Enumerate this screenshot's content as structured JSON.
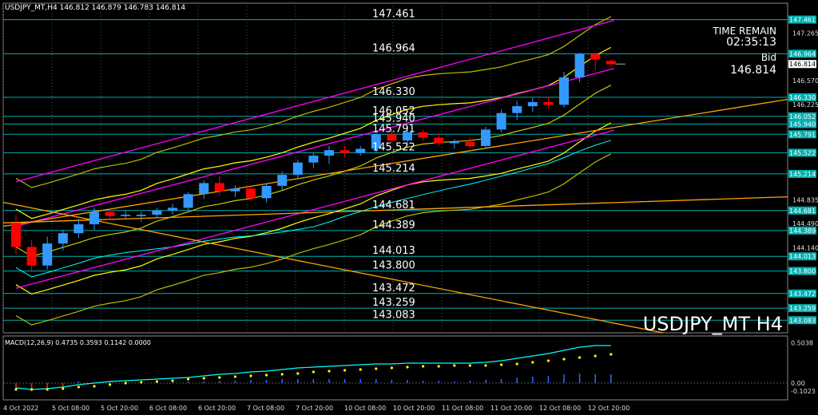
{
  "header": {
    "symbol_info": "USDJPY_MT,H4  146.812 146.879 146.783 146.814"
  },
  "watermark": "USDJPY_MT H4",
  "time_remain": {
    "label": "TIME REMAIN",
    "value": "02:35:13"
  },
  "bid": {
    "label": "Bid",
    "value": "146.814"
  },
  "colors": {
    "background": "#000000",
    "bull": "#3399ff",
    "bear": "#ff0000",
    "level_line": "#00b0b0",
    "yellow": "#ffff00",
    "magenta": "#ff00ff",
    "orange": "#ffa500",
    "cyan": "#00ffff"
  },
  "chart_data": [
    {
      "type": "candlestick",
      "title": "USDJPY_MT H4",
      "ylim": [
        142.9,
        147.7
      ],
      "y_ticks": [
        "147.265",
        "146.570",
        "146.225",
        "144.835",
        "144.490",
        "144.140"
      ],
      "x_tick_labels": [
        "4 Oct 2022",
        "5 Oct 08:00",
        "5 Oct 20:00",
        "6 Oct 08:00",
        "6 Oct 20:00",
        "7 Oct 08:00",
        "7 Oct 20:00",
        "10 Oct 08:00",
        "10 Oct 20:00",
        "11 Oct 08:00",
        "11 Oct 20:00",
        "12 Oct 08:00",
        "12 Oct 20:00"
      ],
      "levels": [
        {
          "value": 147.461,
          "label": "147.461"
        },
        {
          "value": 146.964,
          "label": "146.964"
        },
        {
          "value": 146.33,
          "label": "146.330"
        },
        {
          "value": 146.052,
          "label": "146.052"
        },
        {
          "value": 145.94,
          "label": "145.940"
        },
        {
          "value": 145.791,
          "label": "145.791"
        },
        {
          "value": 145.522,
          "label": "145.522"
        },
        {
          "value": 145.214,
          "label": "145.214"
        },
        {
          "value": 144.681,
          "label": "144.681"
        },
        {
          "value": 144.389,
          "label": "144.389"
        },
        {
          "value": 144.013,
          "label": "144.013"
        },
        {
          "value": 143.8,
          "label": "143.800"
        },
        {
          "value": 143.472,
          "label": "143.472"
        },
        {
          "value": 143.259,
          "label": "143.259"
        },
        {
          "value": 143.083,
          "label": "143.083"
        }
      ],
      "current_price": {
        "value": 146.814,
        "label": "146.814"
      },
      "candles": [
        [
          144.5,
          144.62,
          144.05,
          144.15
        ],
        [
          144.15,
          144.25,
          143.8,
          143.88
        ],
        [
          143.88,
          144.3,
          143.82,
          144.2
        ],
        [
          144.2,
          144.4,
          144.1,
          144.35
        ],
        [
          144.35,
          144.56,
          144.28,
          144.48
        ],
        [
          144.48,
          144.72,
          144.4,
          144.66
        ],
        [
          144.66,
          144.72,
          144.55,
          144.6
        ],
        [
          144.6,
          144.68,
          144.56,
          144.62
        ],
        [
          144.6,
          144.66,
          144.52,
          144.62
        ],
        [
          144.62,
          144.72,
          144.58,
          144.68
        ],
        [
          144.68,
          144.78,
          144.62,
          144.72
        ],
        [
          144.72,
          144.95,
          144.68,
          144.92
        ],
        [
          144.92,
          145.12,
          144.85,
          145.08
        ],
        [
          145.08,
          145.18,
          144.9,
          144.96
        ],
        [
          144.96,
          145.05,
          144.88,
          145.0
        ],
        [
          145.0,
          145.02,
          144.82,
          144.86
        ],
        [
          144.86,
          145.08,
          144.8,
          145.04
        ],
        [
          145.04,
          145.25,
          144.98,
          145.2
        ],
        [
          145.2,
          145.42,
          145.15,
          145.38
        ],
        [
          145.38,
          145.52,
          145.3,
          145.48
        ],
        [
          145.48,
          145.62,
          145.36,
          145.56
        ],
        [
          145.56,
          145.62,
          145.46,
          145.52
        ],
        [
          145.52,
          145.62,
          145.48,
          145.58
        ],
        [
          145.58,
          145.84,
          145.52,
          145.79
        ],
        [
          145.79,
          145.86,
          145.66,
          145.7
        ],
        [
          145.7,
          145.88,
          145.64,
          145.82
        ],
        [
          145.82,
          145.86,
          145.7,
          145.74
        ],
        [
          145.74,
          145.8,
          145.62,
          145.66
        ],
        [
          145.66,
          145.72,
          145.58,
          145.68
        ],
        [
          145.68,
          145.75,
          145.58,
          145.62
        ],
        [
          145.62,
          145.9,
          145.58,
          145.86
        ],
        [
          145.86,
          146.15,
          145.82,
          146.1
        ],
        [
          146.1,
          146.28,
          146.0,
          146.2
        ],
        [
          146.2,
          146.32,
          146.12,
          146.26
        ],
        [
          146.26,
          146.34,
          146.16,
          146.22
        ],
        [
          146.22,
          146.7,
          146.18,
          146.62
        ],
        [
          146.62,
          146.98,
          146.55,
          146.96
        ],
        [
          146.96,
          146.98,
          146.72,
          146.88
        ],
        [
          146.86,
          146.88,
          146.78,
          146.81
        ]
      ]
    },
    {
      "type": "line",
      "title": "MACD(12,26,9) 0.4735 0.3593 0.1142 0.0000",
      "ylim": [
        -0.2,
        0.56
      ],
      "y_ticks": [
        "0.5038",
        "0.00",
        "-0.1023"
      ],
      "series": [
        {
          "name": "MACD",
          "values": [
            -0.06,
            -0.08,
            -0.07,
            -0.05,
            -0.02,
            0.0,
            0.02,
            0.03,
            0.04,
            0.05,
            0.06,
            0.07,
            0.09,
            0.11,
            0.12,
            0.14,
            0.15,
            0.17,
            0.19,
            0.2,
            0.21,
            0.22,
            0.23,
            0.24,
            0.24,
            0.25,
            0.25,
            0.25,
            0.25,
            0.25,
            0.26,
            0.28,
            0.31,
            0.34,
            0.37,
            0.41,
            0.45,
            0.47,
            0.47
          ]
        },
        {
          "name": "Signal",
          "values": [
            -0.08,
            -0.08,
            -0.08,
            -0.07,
            -0.05,
            -0.04,
            -0.02,
            0.0,
            0.01,
            0.02,
            0.03,
            0.05,
            0.06,
            0.07,
            0.08,
            0.09,
            0.1,
            0.11,
            0.12,
            0.14,
            0.15,
            0.16,
            0.17,
            0.18,
            0.19,
            0.2,
            0.21,
            0.21,
            0.22,
            0.22,
            0.22,
            0.23,
            0.24,
            0.26,
            0.28,
            0.3,
            0.32,
            0.34,
            0.36
          ]
        },
        {
          "name": "Histogram",
          "values": [
            -0.08,
            -0.1,
            -0.09,
            -0.07,
            0.02,
            0.01,
            0.02,
            0.02,
            0.02,
            0.02,
            0.02,
            0.02,
            0.02,
            0.03,
            0.03,
            0.04,
            0.04,
            0.05,
            0.05,
            0.05,
            0.05,
            0.05,
            0.05,
            0.05,
            0.04,
            0.04,
            0.03,
            0.03,
            0.02,
            0.03,
            0.04,
            0.05,
            0.07,
            0.08,
            0.09,
            0.11,
            0.12,
            0.11,
            0.11
          ]
        }
      ]
    }
  ]
}
